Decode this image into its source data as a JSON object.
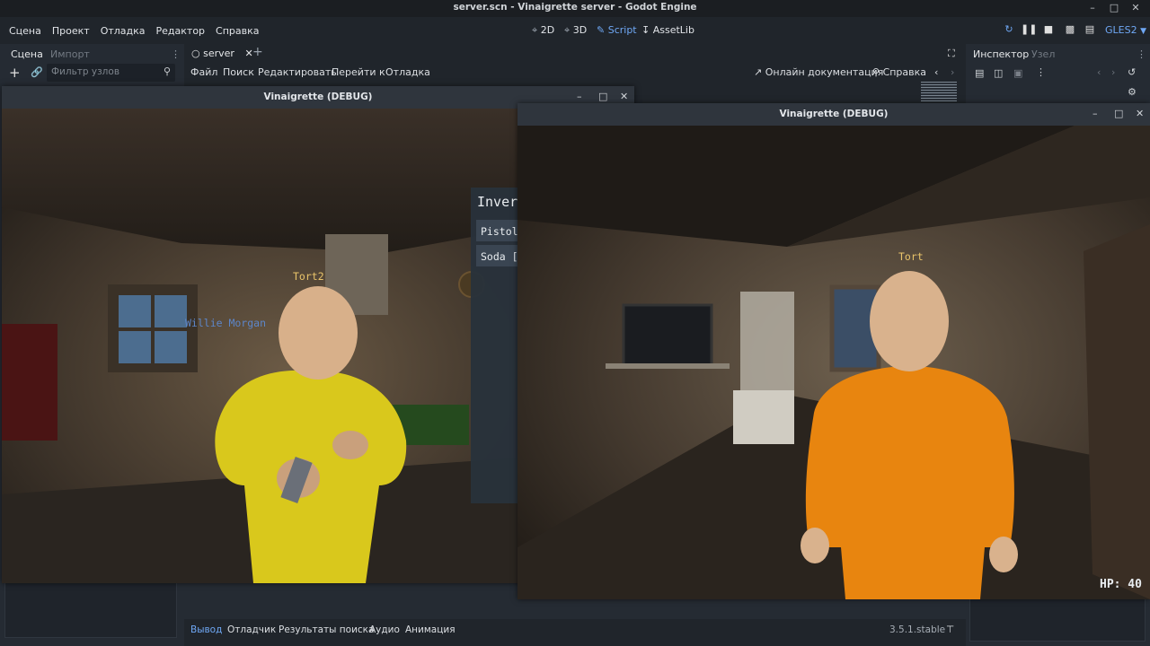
{
  "window": {
    "title": "server.scn - Vinaigrette server - Godot Engine"
  },
  "menu": {
    "items": [
      "Сцена",
      "Проект",
      "Отладка",
      "Редактор",
      "Справка"
    ]
  },
  "workspaces": {
    "w2d": "2D",
    "w3d": "3D",
    "script": "Script",
    "assetlib": "AssetLib"
  },
  "renderer": "GLES2",
  "left_dock": {
    "tab_scene": "Сцена",
    "tab_import": "Импорт",
    "filter_placeholder": "Фильтр узлов"
  },
  "script_editor": {
    "tab_name": "server",
    "menu": [
      "Файл",
      "Поиск",
      "Редактировать",
      "Перейти к",
      "Отладка"
    ],
    "online_docs": "Онлайн документация",
    "help": "Справка"
  },
  "right_dock": {
    "tab_inspector": "Инспектор",
    "tab_node": "Узел"
  },
  "bottom_panel": {
    "tabs": [
      "Вывод",
      "Отладчик",
      "Результаты поиска",
      "Аудио",
      "Анимация"
    ],
    "version": "3.5.1.stable"
  },
  "debug_window_1": {
    "title": "Vinaigrette (DEBUG)",
    "label_player": "Tort2",
    "label_npc": "Willie Morgan",
    "inventory_title": "Inver",
    "inventory_items": [
      "Pistol",
      "Soda ["
    ]
  },
  "debug_window_2": {
    "title": "Vinaigrette (DEBUG)",
    "label_player": "Tort",
    "hp": "HP: 40"
  },
  "colors": {
    "accent": "#6fa8f5",
    "yellow_suit": "#e3d21a",
    "orange_suit": "#f08c14",
    "tort2_label": "#e9c46a",
    "npc_label": "#5d86c9"
  }
}
